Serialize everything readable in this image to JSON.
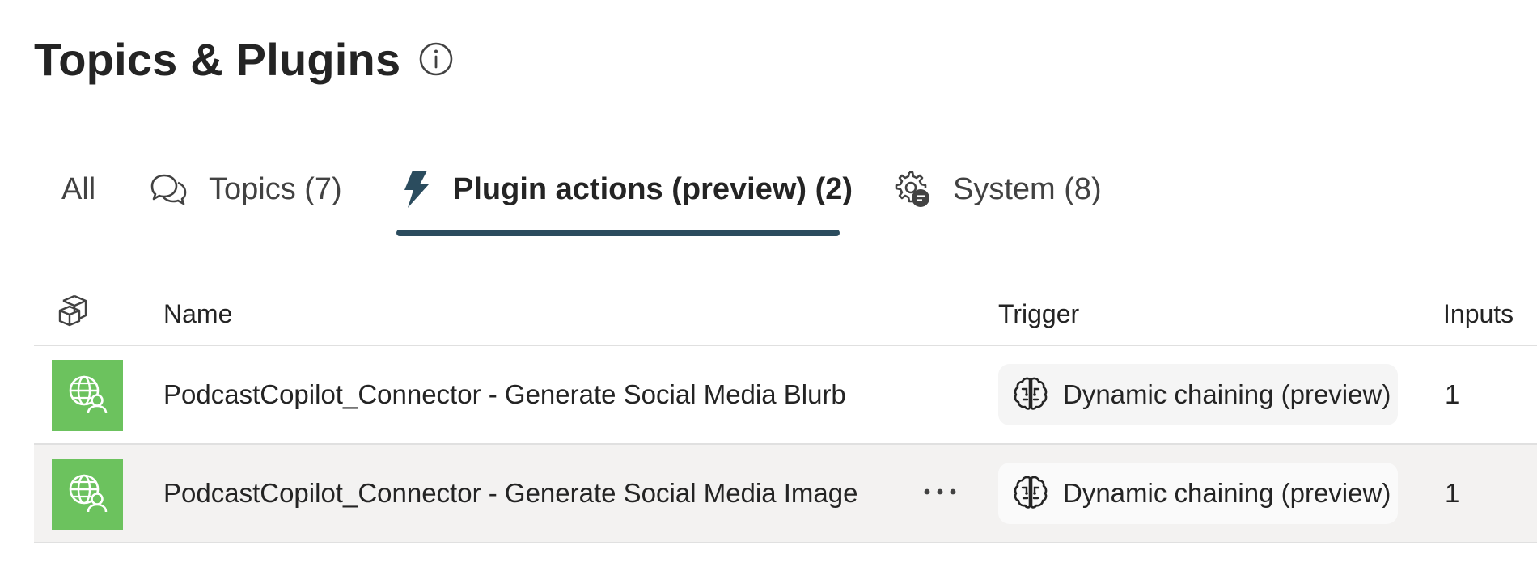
{
  "header": {
    "title": "Topics & Plugins",
    "info_icon": "info-icon"
  },
  "tabs": [
    {
      "label": "All",
      "icon": ""
    },
    {
      "label": "Topics (7)",
      "icon": "chat-bubbles-icon"
    },
    {
      "label": "Plugin actions (preview) (2)",
      "icon": "lightning-icon",
      "active": true
    },
    {
      "label": "System (8)",
      "icon": "gear-chat-icon"
    }
  ],
  "table": {
    "columns": {
      "type_icon": "cube-icon",
      "name": "Name",
      "trigger": "Trigger",
      "inputs": "Inputs"
    },
    "rows": [
      {
        "icon": "globe-person-icon",
        "name": "PodcastCopilot_Connector - Generate Social Media Blurb",
        "trigger": "Dynamic chaining (preview)",
        "trigger_icon": "brain-icon",
        "inputs": "1",
        "selected": false
      },
      {
        "icon": "globe-person-icon",
        "name": "PodcastCopilot_Connector - Generate Social Media Image",
        "trigger": "Dynamic chaining (preview)",
        "trigger_icon": "brain-icon",
        "inputs": "1",
        "selected": true,
        "more_icon": "more-horizontal-icon"
      }
    ]
  },
  "colors": {
    "accent_underline": "#2b4c5e",
    "icon_tile": "#6cc25e",
    "selected_row": "#f3f2f1"
  }
}
